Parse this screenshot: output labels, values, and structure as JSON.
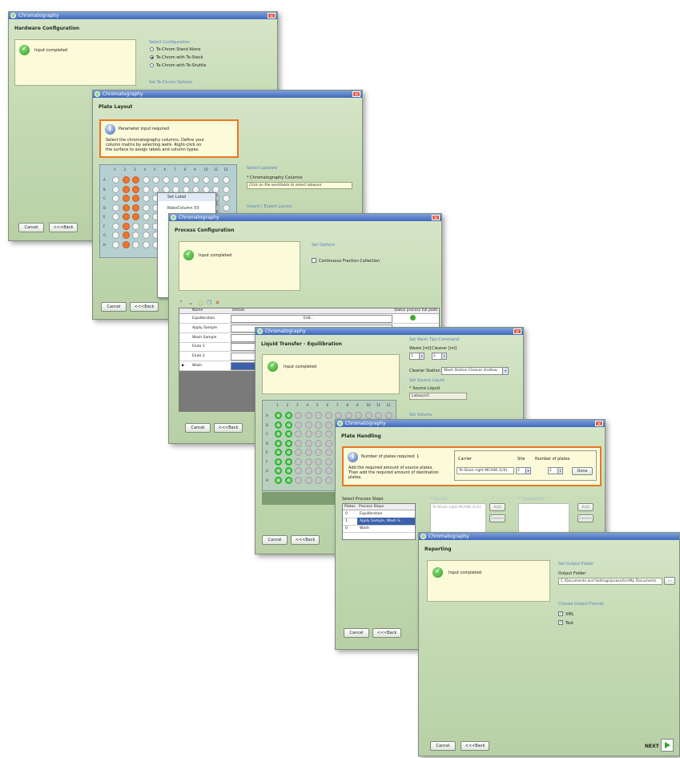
{
  "windows": {
    "w1": {
      "title": "Chromatography",
      "heading": "Hardware Configuration",
      "status": "Input completed",
      "select_config_label": "Select Configuration",
      "options": [
        "Te-Chrom Stand Alone",
        "Te-Chrom with Te-Stack",
        "Te-Chrom with Te-Shuttle"
      ],
      "selected_option": "Te-Chrom with Te-Stack",
      "set_options_label": "Set Te-Chrom Options",
      "cancel_label": "Cancel",
      "back_label": "<<<Back"
    },
    "w2": {
      "title": "Chromatography",
      "heading": "Plate Layout",
      "status_title": "Parameter input required",
      "status_body": "Select the chromatography columns. Define your column matrix by selecting wells. Right-click on the surface to assign labels and column types.",
      "select_labware_label": "Select Labware",
      "columns_label": "* Chromatography Columns",
      "columns_placeholder": "Click on the worktable to select labware",
      "import_export_label": "Import / Export Layout",
      "context_menu": [
        "Set Label",
        "RoboColumn 50"
      ],
      "col_numbers": [
        "1",
        "2",
        "3",
        "4",
        "5",
        "6",
        "7",
        "8",
        "9",
        "10",
        "11",
        "12"
      ],
      "row_letters": [
        "A",
        "B",
        "C",
        "D",
        "E",
        "F",
        "G",
        "H"
      ],
      "cancel_label": "Cancel",
      "back_label": "<<<Back"
    },
    "w3": {
      "title": "Chromatography",
      "heading": "Process Configuration",
      "status": "Input completed",
      "set_options_label": "Set Options",
      "continuous_label": "Continuous Fraction Collection",
      "table_headers": [
        "Name",
        "Details",
        "Status process full plate"
      ],
      "rows": [
        "Equilibration",
        "Apply Sample",
        "Wash Sample",
        "Elute 1",
        "Elute 2",
        "Wash"
      ],
      "edit_label": "Edit...",
      "cancel_label": "Cancel",
      "back_label": "<<<Back"
    },
    "w4": {
      "title": "Chromatography",
      "heading": "Liquid Transfer - Equilibration",
      "status": "Input completed",
      "wash_tips_label": "Set Wash Tips Command",
      "waste_label": "Waste [ml]",
      "cleaner_label": "Cleaner [ml]",
      "waste_value": "1",
      "cleaner_value": "2",
      "cleaner_station_label": "Cleaner Station",
      "cleaner_station_value": "Wash Station Cleaner shallow",
      "set_source_label": "Set Source Liquid",
      "source_label": "* Source Liquid",
      "source_value": "Labware5",
      "set_volume_label": "Set Volume",
      "col_numbers": [
        "1",
        "2",
        "3",
        "4",
        "5",
        "6",
        "7",
        "8",
        "9",
        "10",
        "11",
        "12"
      ],
      "row_letters": [
        "A",
        "B",
        "C",
        "D",
        "E",
        "F",
        "G",
        "H"
      ],
      "cancel_label": "Cancel",
      "back_label": "<<<Back"
    },
    "w5": {
      "title": "Chromatography",
      "heading": "Plate Handling",
      "status_title": "Number of plates required: 1",
      "status_body": "Add the required amount of source plates. Then add the required amount of destination plates.",
      "carrier_label": "Carrier",
      "site_label": "Site",
      "num_plates_label": "Number of plates",
      "carrier_value": "Te-Stack right MCA96 (1/0)",
      "site_value": "2",
      "num_plates_value": "1",
      "done_label": "Done",
      "select_steps_label": "Select Process Steps",
      "steps_headers": [
        "Plates",
        "Process Steps"
      ],
      "steps": [
        {
          "plates": "0",
          "step": "Equilibration"
        },
        {
          "plates": "1",
          "step": "Apply Sample, Wash S..."
        },
        {
          "plates": "0",
          "step": "Wash"
        }
      ],
      "source_label": "* Source",
      "source_item": "Te-Stack right MCA96 (1/1)",
      "destination_label": "* Destination",
      "add_label": "Add",
      "delete_label": "Delete",
      "cancel_label": "Cancel",
      "back_label": "<<<Back"
    },
    "w6": {
      "title": "Chromatography",
      "heading": "Reporting",
      "status": "Input completed",
      "set_output_label": "Set Output Folder",
      "output_folder_label": "Output Folder",
      "output_folder_value": "C:\\Documents and Settings\\pvass4cn\\My Documents",
      "browse_label": "...",
      "choose_format_label": "Choose Output Format",
      "formats": [
        "XML",
        "Text"
      ],
      "next_label": "NEXT",
      "cancel_label": "Cancel",
      "back_label": "<<<Back"
    }
  },
  "colors": {
    "accent_orange": "#e87822",
    "title_blue": "#3f69be",
    "panel_green": "#c5dab4"
  }
}
